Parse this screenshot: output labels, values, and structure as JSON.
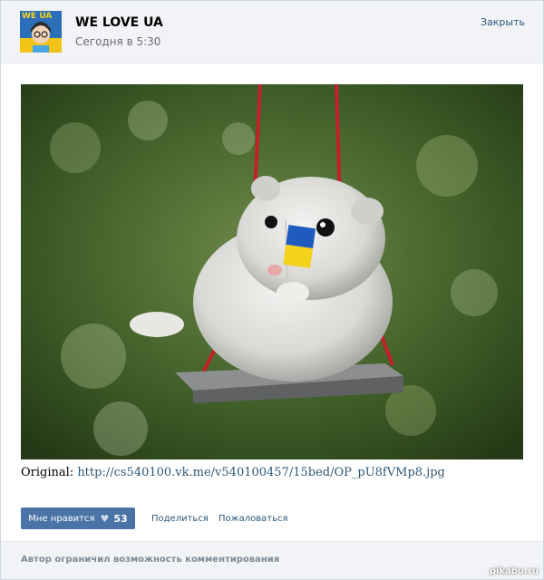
{
  "header": {
    "group_name": "WE LOVE UA",
    "timestamp": "Сегодня в 5:30",
    "close_label": "Закрыть",
    "avatar_text": "WE UA"
  },
  "post": {
    "source_label": "Original:",
    "source_url": "http://cs540100.vk.me/v540100457/15bed/OP_pU8fVMp8.jpg"
  },
  "actions": {
    "like_label": "Мне нравится",
    "like_count": "53",
    "share_label": "Поделиться",
    "report_label": "Пожаловаться"
  },
  "footer": {
    "comments_disabled": "Автор ограничил возможность комментирования"
  },
  "watermark": "pikabu.ru",
  "colors": {
    "header_bg": "#f1f3f6",
    "link": "#2b587a",
    "like_button": "#4a74a5",
    "flag_blue": "#1f5bbf",
    "flag_yellow": "#f5d21c"
  }
}
